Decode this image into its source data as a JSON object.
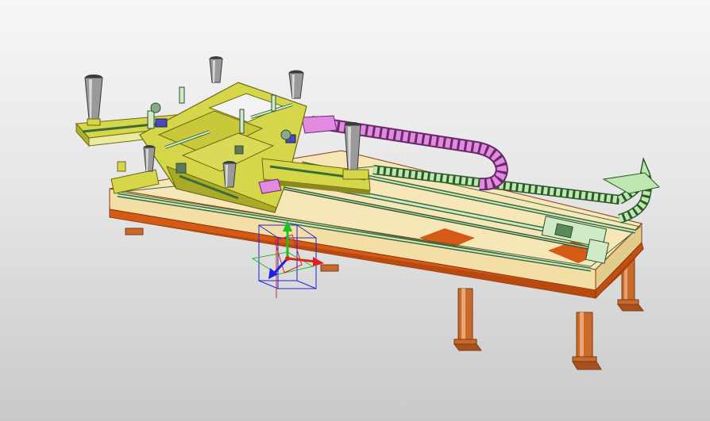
{
  "viewport": {
    "background_top": "#f6f6f6",
    "background_bottom": "#c9c9c9"
  },
  "model": {
    "palette": {
      "frame_top": "#f6e6b8",
      "frame_face": "#f3dfa6",
      "frame_orange": "#d45a15",
      "frame_dark": "#8a3a10",
      "leg": "#c96a2a",
      "leg_dark": "#7a3a12",
      "rail_green": "#cfeac6",
      "rail_dark": "#3b6b3b",
      "gantry_yellow": "#d6d64a",
      "gantry_dark": "#6b6b10",
      "drag_chain_pink": "#e08ae0",
      "drag_chain_green": "#bfe8b0",
      "cone_grey": "#9a9a9a",
      "cone_dark": "#3a3a3a"
    },
    "triad_axes": [
      {
        "axis": "x",
        "color": "#e02020"
      },
      {
        "axis": "y",
        "color": "#20c020"
      },
      {
        "axis": "z",
        "color": "#2020e0"
      }
    ]
  }
}
